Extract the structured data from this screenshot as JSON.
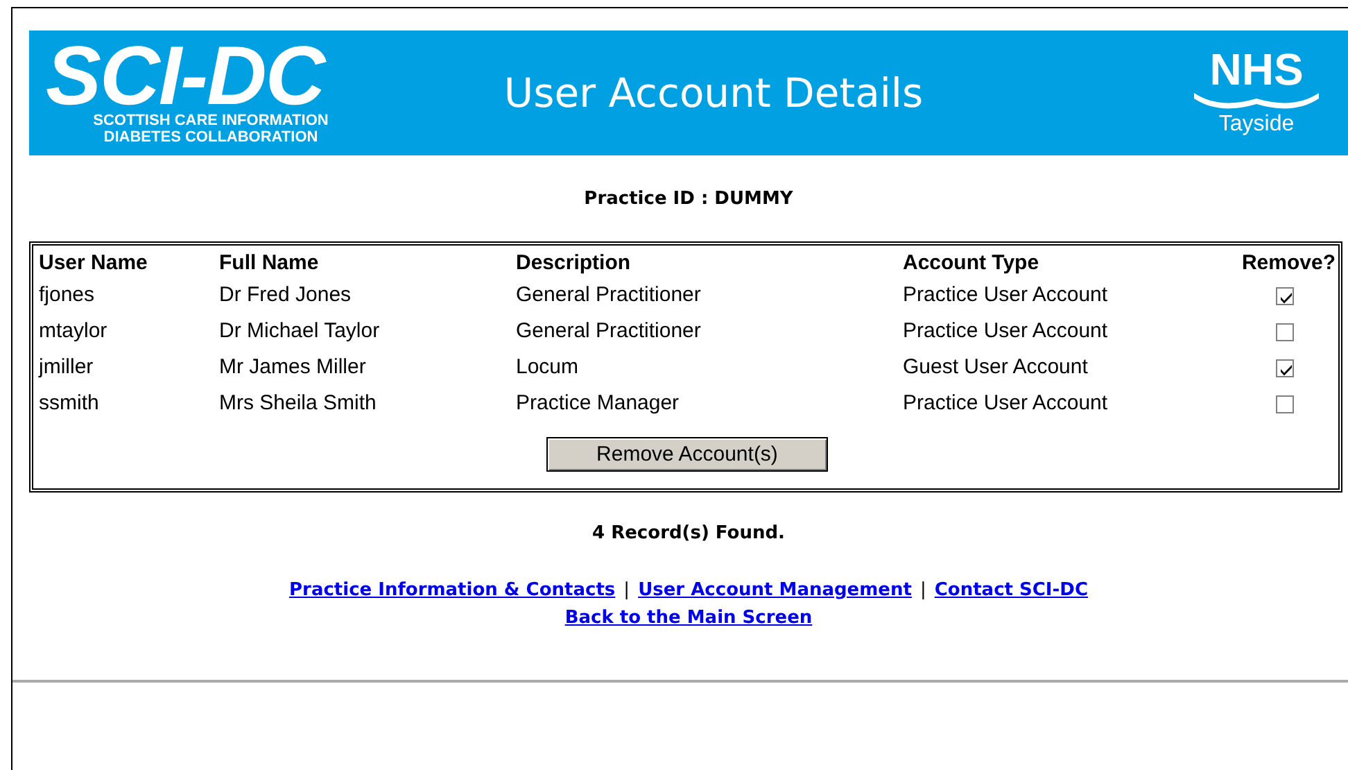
{
  "banner": {
    "logo_title": "SCI-DC",
    "logo_subtitle_1": "SCOTTISH CARE INFORMATION",
    "logo_subtitle_2": "DIABETES COLLABORATION",
    "title": "User Account Details",
    "nhs_title": "NHS",
    "nhs_region": "Tayside"
  },
  "practice_id": "Practice ID : DUMMY",
  "table": {
    "columns": [
      "User Name",
      "Full Name",
      "Description",
      "Account Type",
      "Remove?"
    ],
    "rows": [
      {
        "user_name": "fjones",
        "full_name": "Dr Fred Jones",
        "description": "General Practitioner",
        "account_type": "Practice User Account",
        "remove": true
      },
      {
        "user_name": "mtaylor",
        "full_name": "Dr Michael Taylor",
        "description": "General Practitioner",
        "account_type": "Practice User Account",
        "remove": false
      },
      {
        "user_name": "jmiller",
        "full_name": "Mr James Miller",
        "description": "Locum",
        "account_type": "Guest User Account",
        "remove": true
      },
      {
        "user_name": "ssmith",
        "full_name": "Mrs Sheila Smith",
        "description": "Practice Manager",
        "account_type": "Practice User Account",
        "remove": false
      }
    ],
    "button": "Remove Account(s)"
  },
  "records_found": "4 Record(s) Found.",
  "footer_links": [
    [
      {
        "kind": "link",
        "label": "Practice Information & Contacts"
      },
      {
        "kind": "separator",
        "label": "|"
      },
      {
        "kind": "link",
        "label": "User Account Management"
      },
      {
        "kind": "separator",
        "label": "|"
      },
      {
        "kind": "link",
        "label": "Contact SCI-DC"
      }
    ],
    [
      {
        "kind": "link",
        "label": "Back to the Main Screen"
      }
    ]
  ]
}
